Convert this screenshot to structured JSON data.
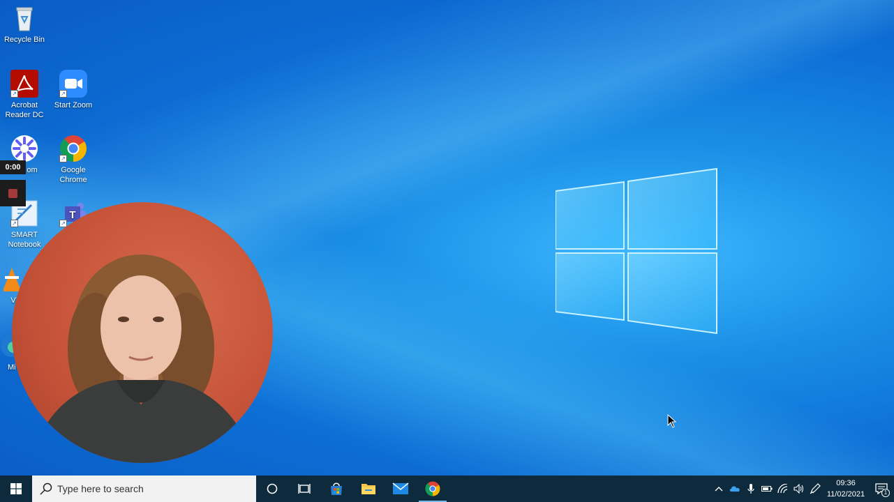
{
  "desktop": {
    "icons": [
      {
        "label": "Recycle Bin",
        "icon": "recycle-bin-icon"
      },
      {
        "label": "Acrobat Reader DC",
        "icon": "acrobat-icon"
      },
      {
        "label": "Start Zoom",
        "icon": "zoom-icon"
      },
      {
        "label": "om",
        "icon": "loom-icon"
      },
      {
        "label": "Google Chrome",
        "icon": "chrome-icon"
      },
      {
        "label": "SMART Notebook",
        "icon": "smart-notebook-icon"
      },
      {
        "label": "",
        "icon": "teams-icon"
      },
      {
        "label": "VL",
        "icon": "vlc-icon"
      },
      {
        "label": "Mi E",
        "icon": "edge-icon"
      }
    ]
  },
  "recorder": {
    "time": "0:00"
  },
  "taskbar": {
    "search_placeholder": "Type here to search",
    "apps": [
      "cortana",
      "task-view",
      "microsoft-store",
      "file-explorer",
      "mail",
      "chrome"
    ],
    "active_app": "chrome",
    "clock": {
      "time": "09:36",
      "date": "11/02/2021"
    },
    "notification_count": "1"
  },
  "colors": {
    "taskbar": "#0d2b3d",
    "wallpaper": "#0d6fd6",
    "webcam_bg": "#c8553a"
  }
}
